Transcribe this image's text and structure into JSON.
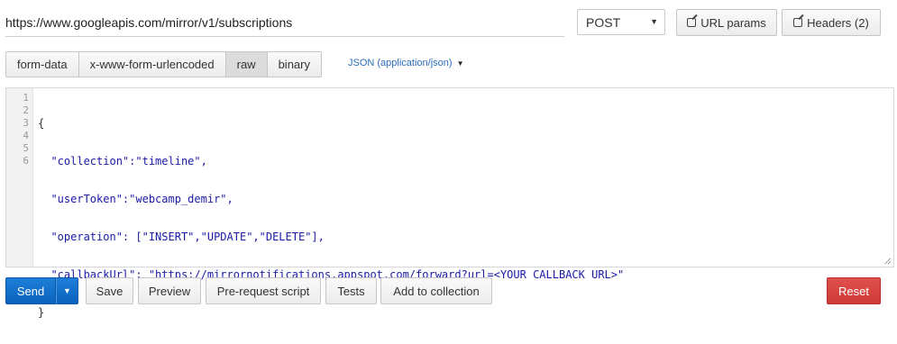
{
  "request": {
    "url": "https://www.googleapis.com/mirror/v1/subscriptions",
    "method": "POST"
  },
  "header_buttons": {
    "url_params": "URL params",
    "headers": "Headers (2)"
  },
  "body_tabs": [
    {
      "label": "form-data",
      "active": false
    },
    {
      "label": "x-www-form-urlencoded",
      "active": false
    },
    {
      "label": "raw",
      "active": true
    },
    {
      "label": "binary",
      "active": false
    }
  ],
  "content_type": "JSON (application/json)",
  "editor": {
    "line_numbers": [
      "1",
      "2",
      "3",
      "4",
      "5",
      "6"
    ],
    "lines": [
      "{",
      "  \"collection\":\"timeline\",",
      "  \"userToken\":\"webcamp_demir\",",
      "  \"operation\": [\"INSERT\",\"UPDATE\",\"DELETE\"],",
      "  \"callbackUrl\": \"https://mirrornotifications.appspot.com/forward?url=<YOUR CALLBACK URL>\"",
      "}"
    ]
  },
  "actions": {
    "send": "Send",
    "save": "Save",
    "preview": "Preview",
    "pre_request": "Pre-request script",
    "tests": "Tests",
    "add_collection": "Add to collection",
    "reset": "Reset"
  },
  "colors": {
    "send": "#0b63be",
    "reset": "#cc3a37",
    "link": "#2a6ebb"
  }
}
